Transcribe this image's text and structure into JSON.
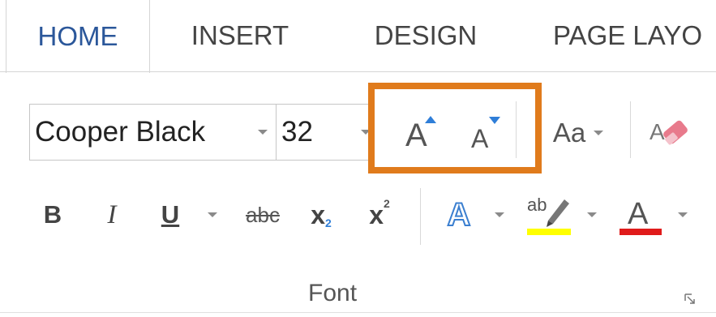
{
  "tabs": [
    {
      "label": "HOME",
      "active": true
    },
    {
      "label": "INSERT",
      "active": false
    },
    {
      "label": "DESIGN",
      "active": false
    },
    {
      "label": "PAGE LAYO",
      "active": false
    }
  ],
  "font_group": {
    "font_name": "Cooper Black",
    "font_size": "32",
    "grow_font_glyph": "A",
    "shrink_font_glyph": "A",
    "change_case_label": "Aa",
    "group_label": "Font",
    "bold_label": "B",
    "italic_label": "I",
    "underline_label": "U",
    "strikethrough_label": "abc",
    "subscript_base": "x",
    "subscript_mark": "2",
    "superscript_base": "x",
    "superscript_mark": "2",
    "text_effects_glyph": "A",
    "highlight_glyph": "ab",
    "font_color_glyph": "A"
  },
  "colors": {
    "active_tab": "#2b579a",
    "highlight_box": "#e07b1c",
    "highlight_color": "#ffff00",
    "font_color": "#e01b1b",
    "text_effects": "#3b7fd0"
  },
  "icons": [
    "dropdown-arrow-icon",
    "clear-formatting-icon",
    "grow-font-icon",
    "shrink-font-icon",
    "dialog-launcher-icon"
  ]
}
